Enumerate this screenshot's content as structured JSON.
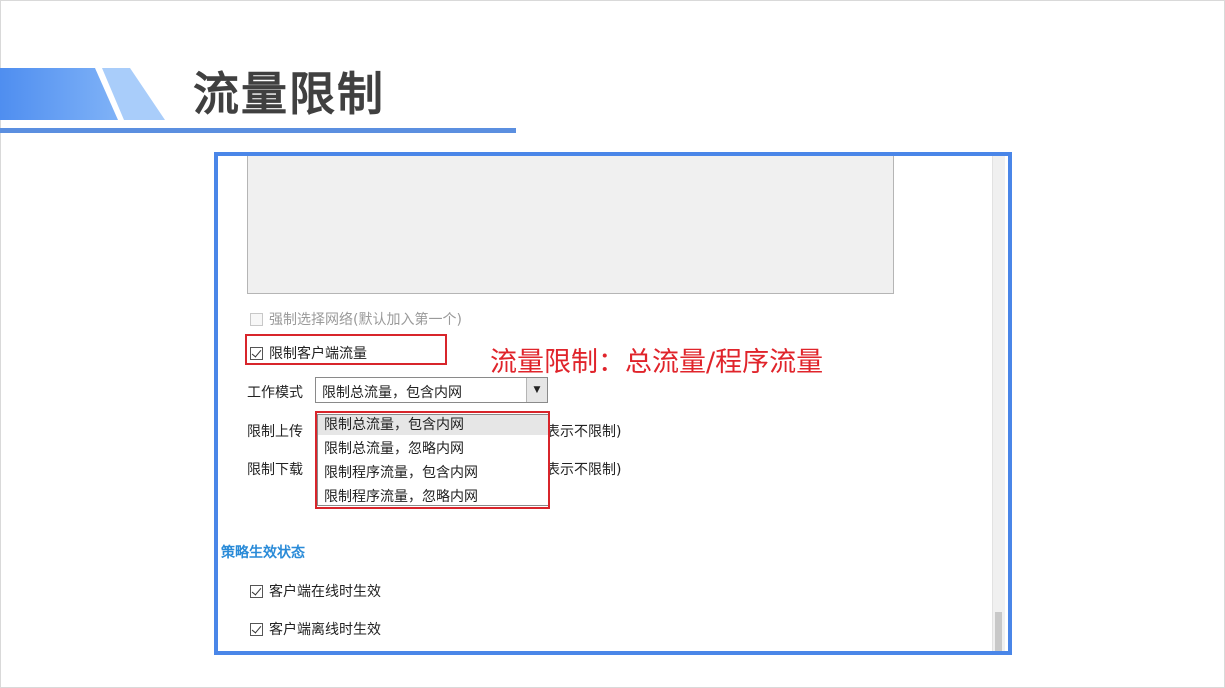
{
  "slide": {
    "title": "流量限制"
  },
  "form": {
    "force_network": {
      "label": "强制选择网络(默认加入第一个)",
      "checked": false,
      "disabled": true
    },
    "limit_client_traffic": {
      "label": "限制客户端流量",
      "checked": true
    },
    "annotation": "流量限制：总流量/程序流量",
    "work_mode": {
      "label": "工作模式",
      "value": "限制总流量，包含内网",
      "options": [
        "限制总流量，包含内网",
        "限制总流量，忽略内网",
        "限制程序流量，包含内网",
        "限制程序流量，忽略内网"
      ]
    },
    "upload_limit": {
      "label_visible": "限制上传",
      "suffix_visible": "表示不限制)"
    },
    "download_limit": {
      "label_visible": "限制下载",
      "suffix_visible": "表示不限制)"
    }
  },
  "policy": {
    "title": "策略生效状态",
    "online": {
      "label": "客户端在线时生效",
      "checked": true
    },
    "offline": {
      "label": "客户端离线时生效",
      "checked": true
    }
  },
  "colors": {
    "accent_blue": "#4a86e8",
    "annotation_red": "#e0242b",
    "section_blue": "#2a8bd8"
  }
}
